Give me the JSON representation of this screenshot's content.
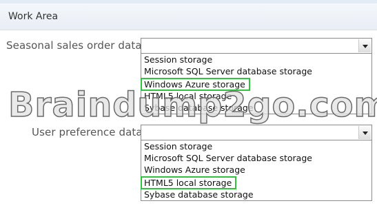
{
  "header": {
    "title": "Work Area"
  },
  "field1": {
    "label": "Seasonal sales order data",
    "selected": "",
    "options": [
      "Session storage",
      "Microsoft SQL Server database storage",
      "Windows Azure storage",
      "HTML5 local storage",
      "Sybase database storage"
    ],
    "highlighted": "Windows Azure storage"
  },
  "field2": {
    "label": "User preference data",
    "selected": "",
    "options": [
      "Session storage",
      "Microsoft SQL Server database storage",
      "Windows Azure storage",
      "HTML5 local storage",
      "Sybase database storage"
    ],
    "highlighted": "HTML5 local storage"
  },
  "watermark": "Braindump2go.com",
  "colors": {
    "highlight": "#2fc43a",
    "header_bg": "#eef2f7"
  }
}
